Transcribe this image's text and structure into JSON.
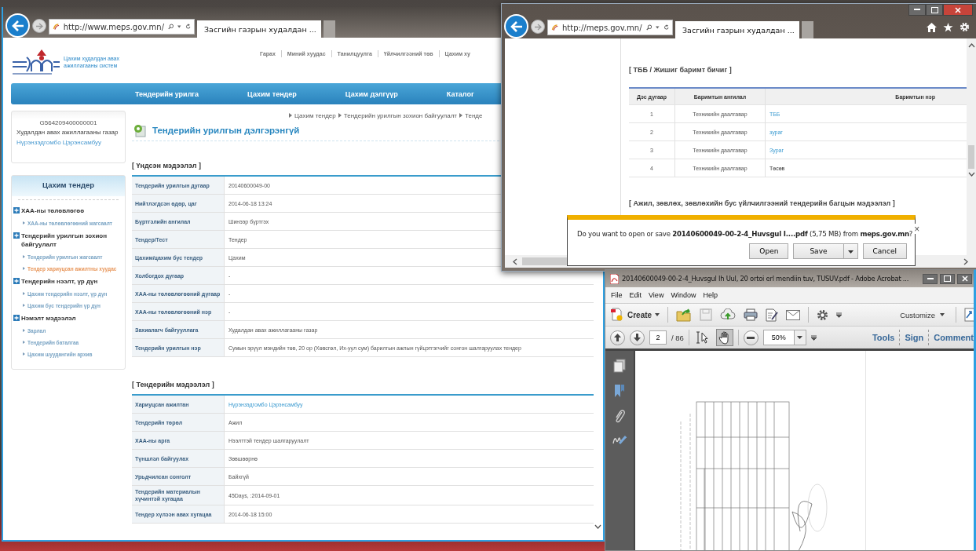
{
  "left_browser": {
    "address": "http://www.meps.gov.mn/",
    "tab_title": "Засгийн газрын худалдан ...",
    "site_name": "Цахим худалдан авах ажиллагааны систем",
    "top_links": [
      "Гарах",
      "Миний хуудас",
      "Танилцуулга",
      "Үйлчилгээний төв",
      "Цахим ху"
    ],
    "nav": [
      "Тендерийн урилга",
      "Цахим тендер",
      "Цахим дэлгүүр",
      "Каталог"
    ],
    "user_card": {
      "code": "G564209400000001",
      "organization": "Худалдан авах ажиллагааны газар",
      "name": "Нүрэнзэдгомбо Цэрэнсамбуу"
    },
    "sidebar": {
      "title": "Цахим тендер",
      "groups": [
        {
          "label": "ХАА-ны төлөвлөгөө",
          "children": [
            {
              "label": "ХАА-ны төлөвлөгөөний жагсаалт",
              "selected": false
            }
          ]
        },
        {
          "label": "Тендерийн урилгын зохион байгуулалт",
          "children": [
            {
              "label": "Тендерийн урилгын жагсаалт",
              "selected": false
            },
            {
              "label": "Тендер хариуцсан ажилтны хуудас",
              "selected": true
            }
          ]
        },
        {
          "label": "Тендерийн нээлт, үр дүн",
          "children": [
            {
              "label": "Цахим тендерийн нээлт, үр дүн",
              "selected": false
            },
            {
              "label": "Цахим бус тендерийн үр дүн",
              "selected": false
            }
          ]
        },
        {
          "label": "Нэмэлт мэдээлэл",
          "children": [
            {
              "label": "Зарлал",
              "selected": false
            },
            {
              "label": "Тендерийн баталгаа",
              "selected": false
            },
            {
              "label": "Цахим шуудангийн архив",
              "selected": false
            }
          ]
        }
      ]
    },
    "breadcrumb": [
      "Цахим тендер",
      "Тендерийн урилгын зохион байгуулалт",
      "Тенде"
    ],
    "page_title": "Тендерийн урилгын дэлгэрэнгүй",
    "sections": [
      {
        "heading": "[ Үндсэн мэдээлэл ]",
        "rows": [
          {
            "label": "Тендерийн урилгын дугаар",
            "value": "20140600049-00",
            "kind": "text"
          },
          {
            "label": "Нийтлэгдсэн өдөр, цаг",
            "value": "2014-06-18 13:24",
            "kind": "text"
          },
          {
            "label": "Бүртгэлийн ангилал",
            "value": "Шинээр бүртгэх",
            "kind": "text"
          },
          {
            "label": "Тендер/Тест",
            "value": "Тендер",
            "kind": "text"
          },
          {
            "label": "Цахим/цахим бус тендер",
            "value": "Цахим",
            "kind": "text"
          },
          {
            "label": "Холбогдох дугаар",
            "value": "-",
            "kind": "text"
          },
          {
            "label": "ХАА-ны төлөвлөгөөний дугаар",
            "value": "-",
            "kind": "text"
          },
          {
            "label": "ХАА-ны төлөвлөгөөний нэр",
            "value": "-",
            "kind": "text"
          },
          {
            "label": "Захиалагч байгууллага",
            "value": "Худалдан авах ажиллагааны газар",
            "kind": "text"
          },
          {
            "label": "Тендерийн урилгын нэр",
            "value": "Сумын эрүүл мэндийн төв, 20 ор (Хөвсгөл, Их-уул сум) барилгын ажлын гүйцэтгэгчийг сонгон шалгаруулах тендер",
            "kind": "text"
          }
        ]
      },
      {
        "heading": "[ Тендерийн мэдээлэл ]",
        "rows": [
          {
            "label": "Хариуцсан ажилтан",
            "value": "Нүрэнзэдгомбо Цэрэнсамбуу",
            "kind": "link"
          },
          {
            "label": "Тендерийн төрөл",
            "value": "Ажил",
            "kind": "text"
          },
          {
            "label": "ХАА-ны арга",
            "value": "Нээлттэй тендер шалгаруулалт",
            "kind": "text"
          },
          {
            "label": "Түншлэл байгуулах",
            "value": "Зөвшөөрнө",
            "kind": "text"
          },
          {
            "label": "Урьдчилсан сонголт",
            "value": "Байхгүй",
            "kind": "text"
          },
          {
            "label": "Тендерийн материалын хүчинтэй хугацаа",
            "value": "45Days,  :2014-09-01",
            "kind": "text"
          },
          {
            "label": "Тендер хүлээн авах хугацаа",
            "value": "2014-06-18 15:00",
            "kind": "text"
          }
        ]
      }
    ]
  },
  "right_browser": {
    "address": "http://meps.gov.mn/",
    "tab_title": "Засгийн газрын худалдан ...",
    "heading": "[ ТББ / Жишиг баримт бичиг ]",
    "columns": [
      "Дэс дугаар",
      "Баримтын ангилал",
      "Баримтын нэр"
    ],
    "rows": [
      {
        "number": "1",
        "category": "Техникийн даалгавар",
        "name": "ТББ",
        "kind": "link"
      },
      {
        "number": "2",
        "category": "Техникийн даалгавар",
        "name": "зураг",
        "kind": "link"
      },
      {
        "number": "3",
        "category": "Техникийн даалгавар",
        "name": "Зураг",
        "kind": "link"
      },
      {
        "number": "4",
        "category": "Техникийн даалгавар",
        "name": "Төсөв",
        "kind": "text"
      }
    ],
    "next_heading": "[ Ажил, зөвлөх, зөвлөхийн бус үйлчилгээний тендерийн багцын мэдээлэл ]"
  },
  "download_bar": {
    "message": "Do you want to open or save **20140600049-00-2-4_Huvsgul I....pdf** (5,75 MB) from **meps.gov.mn**?",
    "close": "×",
    "buttons": [
      "Open",
      "Save",
      "Cancel"
    ]
  },
  "acrobat": {
    "title": "20140600049-00-2-4_Huvsgul Ih Uul, 20 ortoi erl mendiin tuv, TUSUV.pdf - Adobe Acrobat ...",
    "menu": [
      "File",
      "Edit",
      "View",
      "Window",
      "Help"
    ],
    "create": "Create",
    "customize": "Customize",
    "page": "2",
    "page_count": "/ 86",
    "tools": [
      {
        "kind": "select",
        "selected": false
      },
      {
        "kind": "hand",
        "selected": true
      }
    ],
    "zoom": "50%",
    "panes": [
      "Tools",
      "Sign",
      "Comment"
    ]
  }
}
